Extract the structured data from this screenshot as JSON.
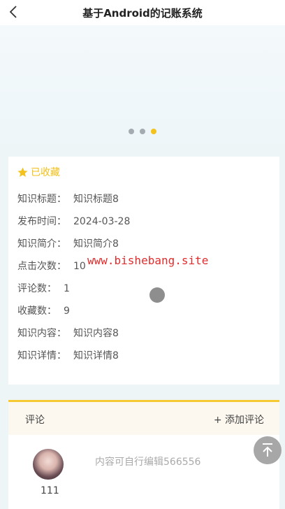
{
  "header": {
    "title": "基于Android的记账系统"
  },
  "banner": {
    "dots": 3,
    "active_dot": 2
  },
  "detail": {
    "favorite_label": "已收藏",
    "fields": [
      {
        "label": "知识标题：",
        "value": "知识标题8"
      },
      {
        "label": "发布时间：",
        "value": "2024-03-28"
      },
      {
        "label": "知识简介：",
        "value": "知识简介8"
      },
      {
        "label": "点击次数：",
        "value": "10"
      },
      {
        "label": "评论数：",
        "value": "1"
      },
      {
        "label": "收藏数：",
        "value": "9"
      },
      {
        "label": "知识内容：",
        "value": "知识内容8"
      },
      {
        "label": "知识详情：",
        "value": "知识详情8"
      }
    ]
  },
  "watermark": "www.bishebang.site",
  "comments": {
    "title": "评论",
    "add_label": "+ 添加评论",
    "items": [
      {
        "user": "111",
        "text": "内容可自行编辑566556"
      }
    ]
  },
  "colors": {
    "accent": "#f3c21c",
    "watermark": "#e02c2c"
  },
  "icons": {
    "back": "chevron-left-icon",
    "favorite": "star-icon",
    "scroll_top": "arrow-up-icon"
  }
}
